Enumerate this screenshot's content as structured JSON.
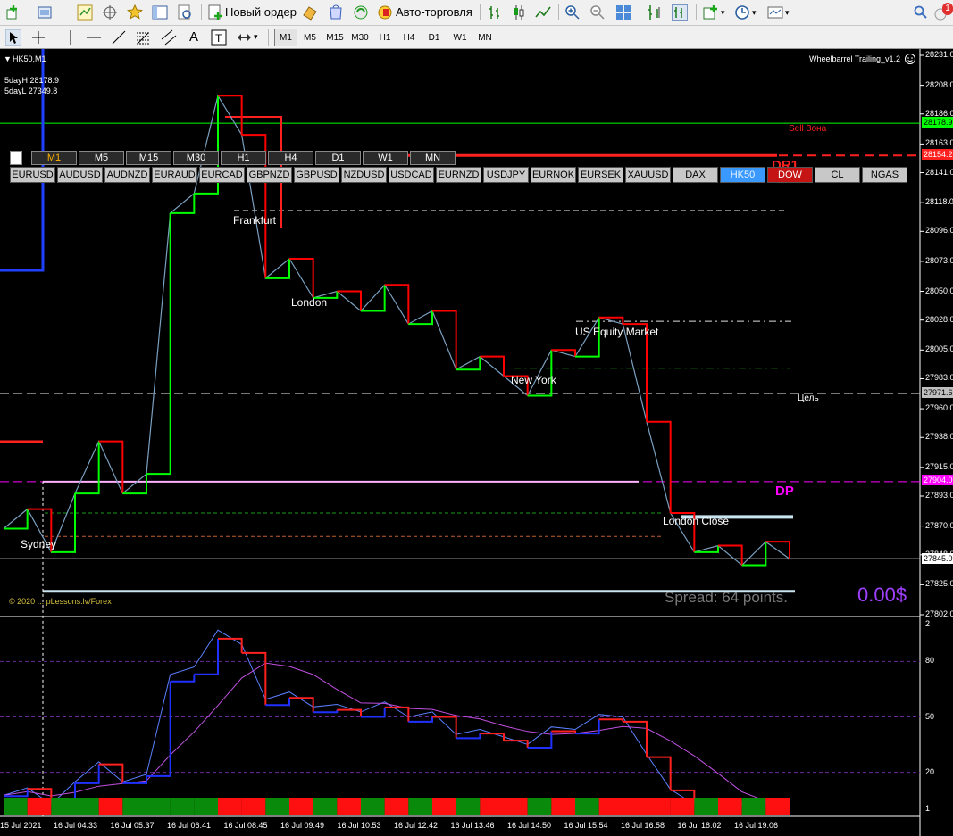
{
  "toolbar": {
    "new_order_label": "Новый ордер",
    "algo_label": "Авто-торговля",
    "timeframes": [
      "M1",
      "M5",
      "M15",
      "M30",
      "H1",
      "H4",
      "D1",
      "W1",
      "MN"
    ],
    "active_timeframe": "M1",
    "notification_count": "1"
  },
  "chart": {
    "symbol_title": "HK50,M1",
    "indicator_name": "Wheelbarrel Trailing_v1.2",
    "five_day_high": "5dayH 28178.9",
    "five_day_low": "5dayL 27349.8",
    "copyright": "© 2020 ... pLessons.lv/Forex",
    "spread_text": "Spread: 64 points.",
    "profit_text": "0.00$",
    "sell_zone": "Sell Зона",
    "target_label": "Цель",
    "dp_label": "DP",
    "dr_label": "DR1",
    "sessions": {
      "frankfurt": "Frankfurt",
      "london": "London",
      "new_york": "New York",
      "us_equity": "US Equity Market",
      "london_close": "London Close",
      "sydney": "Sydney"
    },
    "tf_buttons": [
      "M1",
      "M5",
      "M15",
      "M30",
      "H1",
      "H4",
      "D1",
      "W1",
      "MN"
    ],
    "symbol_buttons": [
      "EURUSD",
      "AUDUSD",
      "AUDNZD",
      "EURAUD",
      "EURCAD",
      "GBPNZD",
      "GBPUSD",
      "NZDUSD",
      "USDCAD",
      "EURNZD",
      "USDJPY",
      "EURNOK",
      "EURSEK",
      "XAUUSD",
      "DAX",
      "HK50",
      "DOW",
      "CL",
      "NGAS"
    ],
    "selected_symbol": "HK50",
    "price_labels": {
      "high": "28178.9",
      "sell": "28154.2",
      "target": "27971.6",
      "dp": "27904.0",
      "bid": "27845.0"
    },
    "colors": {
      "up": "#00ff00",
      "down": "#ff0000",
      "dp": "#ff00ff",
      "accent": "#3a99ff",
      "profit": "#a040ff"
    }
  },
  "chart_data": {
    "type": "line",
    "title": "HK50,M1",
    "price_axis": [
      "28231.0",
      "28208.0",
      "28186.0",
      "28163.0",
      "28141.0",
      "28118.0",
      "28096.0",
      "28073.0",
      "28050.0",
      "28028.0",
      "28005.0",
      "27983.0",
      "27960.0",
      "27938.0",
      "27915.0",
      "27893.0",
      "27870.0",
      "27848.0",
      "27825.0",
      "27802.0"
    ],
    "ylim": [
      27802,
      28231
    ],
    "time_axis": [
      "15 Jul 2021",
      "16 Jul 04:33",
      "16 Jul 05:37",
      "16 Jul 06:41",
      "16 Jul 08:45",
      "16 Jul 09:49",
      "16 Jul 10:53",
      "16 Jul 12:42",
      "16 Jul 13:46",
      "16 Jul 14:50",
      "16 Jul 15:54",
      "16 Jul 16:58",
      "16 Jul 18:02",
      "16 Jul 19:06"
    ],
    "price_series": [
      {
        "x": 0,
        "y": 27868
      },
      {
        "x": 1,
        "y": 27883
      },
      {
        "x": 2,
        "y": 27850
      },
      {
        "x": 3,
        "y": 27895
      },
      {
        "x": 4,
        "y": 27935
      },
      {
        "x": 5,
        "y": 27895
      },
      {
        "x": 6,
        "y": 27910
      },
      {
        "x": 7,
        "y": 28110
      },
      {
        "x": 8,
        "y": 28125
      },
      {
        "x": 9,
        "y": 28200
      },
      {
        "x": 10,
        "y": 28170
      },
      {
        "x": 11,
        "y": 28060
      },
      {
        "x": 12,
        "y": 28075
      },
      {
        "x": 13,
        "y": 28045
      },
      {
        "x": 14,
        "y": 28050
      },
      {
        "x": 15,
        "y": 28035
      },
      {
        "x": 16,
        "y": 28055
      },
      {
        "x": 17,
        "y": 28025
      },
      {
        "x": 18,
        "y": 28035
      },
      {
        "x": 19,
        "y": 27990
      },
      {
        "x": 20,
        "y": 28000
      },
      {
        "x": 21,
        "y": 27985
      },
      {
        "x": 22,
        "y": 27970
      },
      {
        "x": 23,
        "y": 28005
      },
      {
        "x": 24,
        "y": 28000
      },
      {
        "x": 25,
        "y": 28030
      },
      {
        "x": 26,
        "y": 28025
      },
      {
        "x": 27,
        "y": 27950
      },
      {
        "x": 28,
        "y": 27880
      },
      {
        "x": 29,
        "y": 27850
      },
      {
        "x": 30,
        "y": 27855
      },
      {
        "x": 31,
        "y": 27840
      },
      {
        "x": 32,
        "y": 27858
      },
      {
        "x": 33,
        "y": 27845
      }
    ],
    "oscillator_axis": [
      "2",
      "80",
      "50",
      "20",
      "1"
    ],
    "oscillator_levels": [
      80,
      50,
      20
    ]
  }
}
